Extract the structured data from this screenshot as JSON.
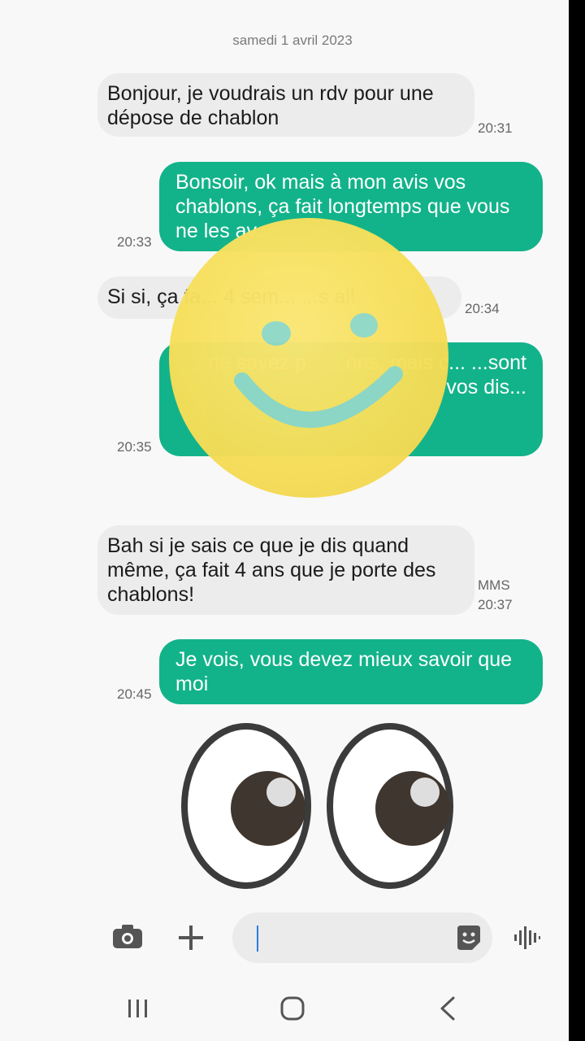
{
  "conversation": {
    "date": "samedi 1 avril 2023",
    "messages": [
      {
        "direction": "in",
        "text": "Bonjour, je voudrais un rdv pour une dépose de chablon",
        "time": "20:31"
      },
      {
        "direction": "out",
        "text": "Bonsoir, ok mais à mon avis vos chablons, ça fait longtemps que vous ne les av...",
        "time": "20:33"
      },
      {
        "direction": "in",
        "text": "Si si, ça fa... 4 sem... ...s ai!",
        "time": "20:34"
      },
      {
        "direction": "out",
        "text": "...ne savez p... ...ons, mais c... ...sont vos dis...",
        "time": "20:35"
      },
      {
        "direction": "in",
        "text": "Bah si je sais ce que je dis quand même,  ça fait 4 ans que je porte des chablons!",
        "time": "20:37",
        "badge": "MMS"
      },
      {
        "direction": "out",
        "text": "Je vois, vous devez mieux savoir que moi",
        "time": "20:45"
      }
    ]
  },
  "stickers": {
    "smiley": "smiley-sticker",
    "eyes": "eyes-emoji"
  },
  "composer": {
    "value": "",
    "placeholder": ""
  },
  "icons": {
    "camera": "camera-icon",
    "plus": "plus-icon",
    "sticker": "sticker-icon",
    "voice": "voice-icon",
    "recents": "recents-icon",
    "home": "home-icon",
    "back": "back-icon"
  },
  "colors": {
    "outgoing": "#12b38a",
    "incoming": "#ececec",
    "background": "#f8f8f8"
  }
}
